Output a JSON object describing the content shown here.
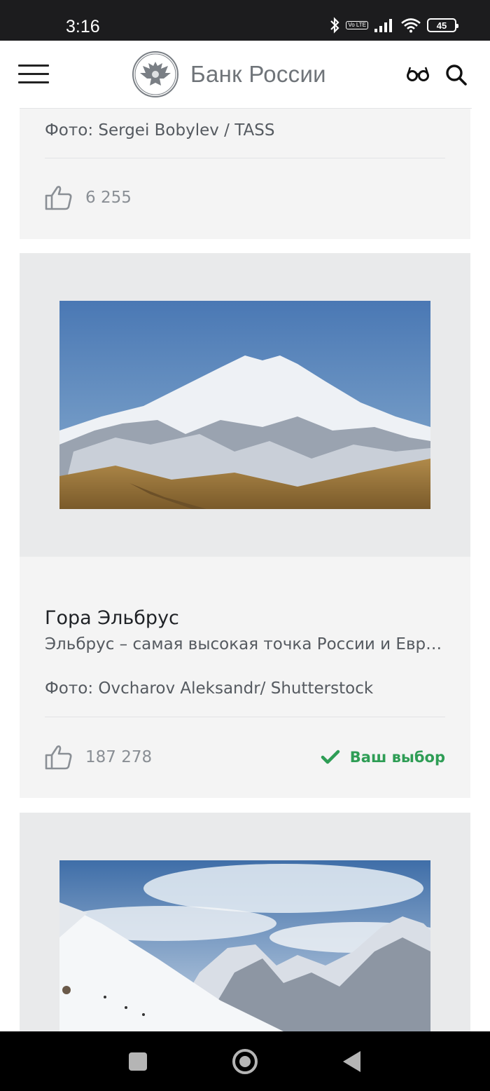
{
  "status_bar": {
    "time": "3:16",
    "volte_label": "Vo LTE",
    "battery": "45",
    "icons": [
      "bluetooth-icon",
      "volte-icon",
      "signal-icon",
      "wifi-icon",
      "battery-icon"
    ]
  },
  "header": {
    "brand_name": "Банк России",
    "icons": [
      "menu-icon",
      "emblem-logo",
      "glasses-icon",
      "search-icon"
    ]
  },
  "cards": [
    {
      "photo_credit": "Фото: Sergei Bobylev / TASS",
      "likes": "6 255"
    },
    {
      "title": "Гора Эльбрус",
      "description": "Эльбрус – самая высокая точка России и Европы",
      "photo_credit": "Фото: Ovcharov Aleksandr/ Shutterstock",
      "likes": "187 278",
      "choice_label": "Ваш выбор"
    },
    {
      "image": "mountain-snow-photo"
    }
  ],
  "colors": {
    "accent_green": "#2e9d55",
    "card_bg": "#f4f4f4",
    "image_bg": "#e9eaeb",
    "status_bar_bg": "#1c1c1e"
  },
  "nav_bar": {
    "icons": [
      "recents-icon",
      "home-icon",
      "back-icon"
    ]
  }
}
